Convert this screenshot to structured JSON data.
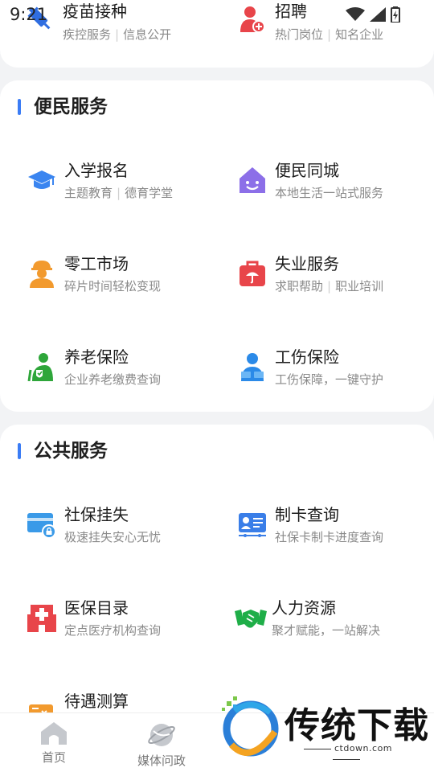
{
  "status_bar": {
    "time": "9:21"
  },
  "top_services": [
    {
      "title": "疫苗接种",
      "desc_a": "疾控服务",
      "desc_b": "信息公开",
      "icon": "syringe-icon"
    },
    {
      "title": "招聘",
      "desc_a": "热门岗位",
      "desc_b": "知名企业",
      "icon": "recruit-person-icon"
    }
  ],
  "section_bm": {
    "title": "便民服务",
    "items": [
      {
        "title": "入学报名",
        "desc_a": "主题教育",
        "desc_b": "德育学堂",
        "icon": "graduation-cap-icon"
      },
      {
        "title": "便民同城",
        "desc_a": "本地生活一站式服务",
        "desc_b": "",
        "icon": "smiling-house-icon"
      },
      {
        "title": "零工市场",
        "desc_a": "碎片时间轻松变现",
        "desc_b": "",
        "icon": "worker-helmet-icon"
      },
      {
        "title": "失业服务",
        "desc_a": "求职帮助",
        "desc_b": "职业培训",
        "icon": "briefcase-umbrella-icon"
      },
      {
        "title": "养老保险",
        "desc_a": "企业养老缴费查询",
        "desc_b": "",
        "icon": "elder-shield-icon"
      },
      {
        "title": "工伤保险",
        "desc_a": "工伤保障，一键守护",
        "desc_b": "",
        "icon": "injured-person-icon"
      }
    ]
  },
  "section_gg": {
    "title": "公共服务",
    "items": [
      {
        "title": "社保挂失",
        "desc_a": "极速挂失安心无忧",
        "desc_b": "",
        "icon": "card-lock-icon"
      },
      {
        "title": "制卡查询",
        "desc_a": "社保卡制卡进度查询",
        "desc_b": "",
        "icon": "id-card-icon"
      },
      {
        "title": "医保目录",
        "desc_a": "定点医疗机构查询",
        "desc_b": "",
        "icon": "hospital-icon"
      },
      {
        "title": "人力资源",
        "desc_a": "聚才赋能，一站解决",
        "desc_b": "",
        "icon": "handshake-icon"
      },
      {
        "title": "待遇测算",
        "desc_a": "",
        "desc_b": "",
        "icon": "calculator-doc-icon"
      }
    ]
  },
  "bottom_nav": [
    {
      "label": "首页",
      "icon": "home-icon"
    },
    {
      "label": "媒体问政",
      "icon": "planet-icon"
    }
  ],
  "watermark": {
    "text": "传统下载",
    "url": "ctdown.com"
  },
  "colors": {
    "accent": "#3b7cf5",
    "title": "#1f1f1f",
    "desc": "#8a8a8a"
  }
}
